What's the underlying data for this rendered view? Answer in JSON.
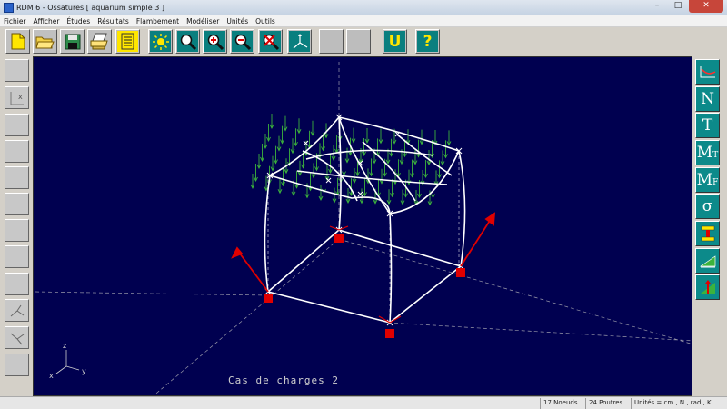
{
  "window": {
    "title": "RDM 6 - Ossatures    [ aquarium simple 3 ]",
    "min_label": "–",
    "max_label": "□",
    "close_label": "✕"
  },
  "menu": [
    "Fichier",
    "Afficher",
    "Études",
    "Résultats",
    "Flambement",
    "Modéliser",
    "Unités",
    "Outils"
  ],
  "toolbar": {
    "help_label": "?",
    "magnet_label": "U"
  },
  "canvas": {
    "background": "#000050",
    "caption": "Cas de charges 2",
    "axes": {
      "z": "z",
      "x": "x",
      "y": "y"
    }
  },
  "left_toolbar": {
    "axis_label": "x"
  },
  "status": {
    "nodes": "17 Noeuds",
    "beams": "24 Poutres",
    "units": "Unités = cm , N , rad , K"
  },
  "colors": {
    "accent": "#0a7f7f",
    "load": "#3cb33c",
    "support": "#e00000"
  }
}
